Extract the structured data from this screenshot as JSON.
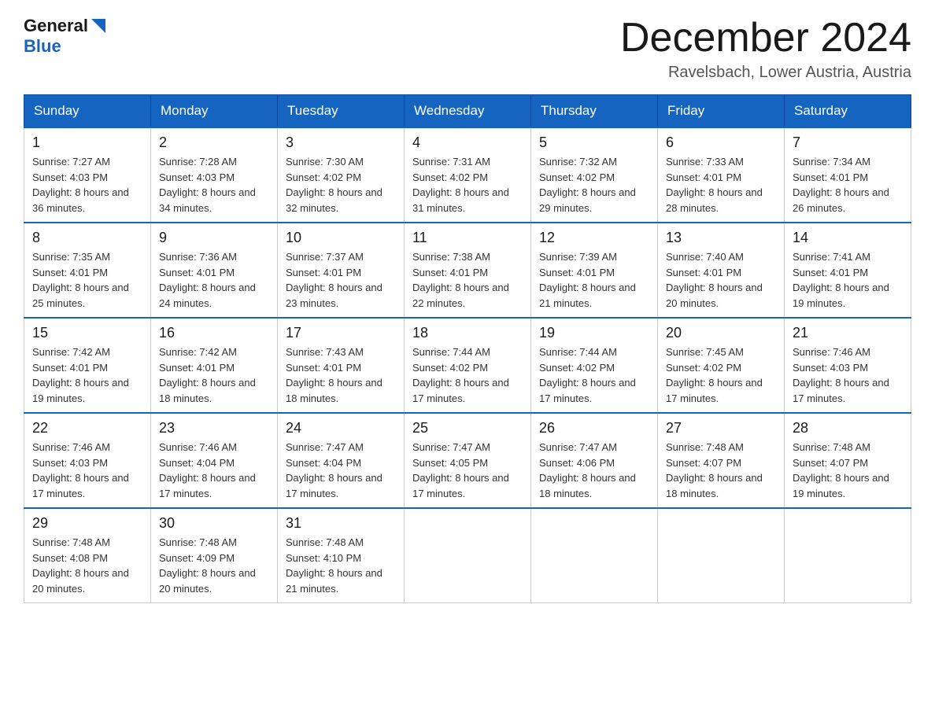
{
  "header": {
    "logo_general": "General",
    "logo_blue": "Blue",
    "month_title": "December 2024",
    "location": "Ravelsbach, Lower Austria, Austria"
  },
  "weekdays": [
    "Sunday",
    "Monday",
    "Tuesday",
    "Wednesday",
    "Thursday",
    "Friday",
    "Saturday"
  ],
  "weeks": [
    [
      {
        "day": "1",
        "sunrise": "7:27 AM",
        "sunset": "4:03 PM",
        "daylight": "8 hours and 36 minutes."
      },
      {
        "day": "2",
        "sunrise": "7:28 AM",
        "sunset": "4:03 PM",
        "daylight": "8 hours and 34 minutes."
      },
      {
        "day": "3",
        "sunrise": "7:30 AM",
        "sunset": "4:02 PM",
        "daylight": "8 hours and 32 minutes."
      },
      {
        "day": "4",
        "sunrise": "7:31 AM",
        "sunset": "4:02 PM",
        "daylight": "8 hours and 31 minutes."
      },
      {
        "day": "5",
        "sunrise": "7:32 AM",
        "sunset": "4:02 PM",
        "daylight": "8 hours and 29 minutes."
      },
      {
        "day": "6",
        "sunrise": "7:33 AM",
        "sunset": "4:01 PM",
        "daylight": "8 hours and 28 minutes."
      },
      {
        "day": "7",
        "sunrise": "7:34 AM",
        "sunset": "4:01 PM",
        "daylight": "8 hours and 26 minutes."
      }
    ],
    [
      {
        "day": "8",
        "sunrise": "7:35 AM",
        "sunset": "4:01 PM",
        "daylight": "8 hours and 25 minutes."
      },
      {
        "day": "9",
        "sunrise": "7:36 AM",
        "sunset": "4:01 PM",
        "daylight": "8 hours and 24 minutes."
      },
      {
        "day": "10",
        "sunrise": "7:37 AM",
        "sunset": "4:01 PM",
        "daylight": "8 hours and 23 minutes."
      },
      {
        "day": "11",
        "sunrise": "7:38 AM",
        "sunset": "4:01 PM",
        "daylight": "8 hours and 22 minutes."
      },
      {
        "day": "12",
        "sunrise": "7:39 AM",
        "sunset": "4:01 PM",
        "daylight": "8 hours and 21 minutes."
      },
      {
        "day": "13",
        "sunrise": "7:40 AM",
        "sunset": "4:01 PM",
        "daylight": "8 hours and 20 minutes."
      },
      {
        "day": "14",
        "sunrise": "7:41 AM",
        "sunset": "4:01 PM",
        "daylight": "8 hours and 19 minutes."
      }
    ],
    [
      {
        "day": "15",
        "sunrise": "7:42 AM",
        "sunset": "4:01 PM",
        "daylight": "8 hours and 19 minutes."
      },
      {
        "day": "16",
        "sunrise": "7:42 AM",
        "sunset": "4:01 PM",
        "daylight": "8 hours and 18 minutes."
      },
      {
        "day": "17",
        "sunrise": "7:43 AM",
        "sunset": "4:01 PM",
        "daylight": "8 hours and 18 minutes."
      },
      {
        "day": "18",
        "sunrise": "7:44 AM",
        "sunset": "4:02 PM",
        "daylight": "8 hours and 17 minutes."
      },
      {
        "day": "19",
        "sunrise": "7:44 AM",
        "sunset": "4:02 PM",
        "daylight": "8 hours and 17 minutes."
      },
      {
        "day": "20",
        "sunrise": "7:45 AM",
        "sunset": "4:02 PM",
        "daylight": "8 hours and 17 minutes."
      },
      {
        "day": "21",
        "sunrise": "7:46 AM",
        "sunset": "4:03 PM",
        "daylight": "8 hours and 17 minutes."
      }
    ],
    [
      {
        "day": "22",
        "sunrise": "7:46 AM",
        "sunset": "4:03 PM",
        "daylight": "8 hours and 17 minutes."
      },
      {
        "day": "23",
        "sunrise": "7:46 AM",
        "sunset": "4:04 PM",
        "daylight": "8 hours and 17 minutes."
      },
      {
        "day": "24",
        "sunrise": "7:47 AM",
        "sunset": "4:04 PM",
        "daylight": "8 hours and 17 minutes."
      },
      {
        "day": "25",
        "sunrise": "7:47 AM",
        "sunset": "4:05 PM",
        "daylight": "8 hours and 17 minutes."
      },
      {
        "day": "26",
        "sunrise": "7:47 AM",
        "sunset": "4:06 PM",
        "daylight": "8 hours and 18 minutes."
      },
      {
        "day": "27",
        "sunrise": "7:48 AM",
        "sunset": "4:07 PM",
        "daylight": "8 hours and 18 minutes."
      },
      {
        "day": "28",
        "sunrise": "7:48 AM",
        "sunset": "4:07 PM",
        "daylight": "8 hours and 19 minutes."
      }
    ],
    [
      {
        "day": "29",
        "sunrise": "7:48 AM",
        "sunset": "4:08 PM",
        "daylight": "8 hours and 20 minutes."
      },
      {
        "day": "30",
        "sunrise": "7:48 AM",
        "sunset": "4:09 PM",
        "daylight": "8 hours and 20 minutes."
      },
      {
        "day": "31",
        "sunrise": "7:48 AM",
        "sunset": "4:10 PM",
        "daylight": "8 hours and 21 minutes."
      },
      null,
      null,
      null,
      null
    ]
  ]
}
